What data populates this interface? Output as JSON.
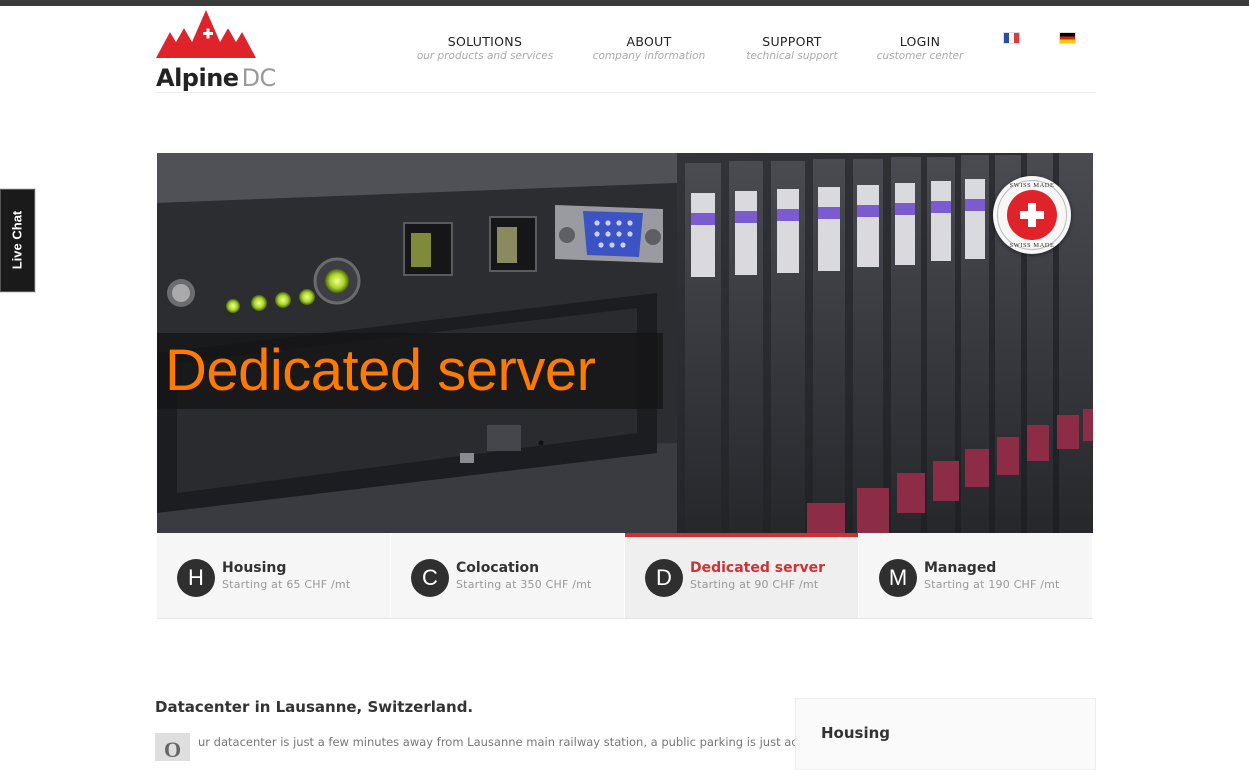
{
  "brand": {
    "name_bold": "Alpine",
    "name_light": "DC"
  },
  "nav": [
    {
      "title": "SOLUTIONS",
      "subtitle": "our products and services"
    },
    {
      "title": "ABOUT",
      "subtitle": "company information"
    },
    {
      "title": "SUPPORT",
      "subtitle": "technical support"
    },
    {
      "title": "LOGIN",
      "subtitle": "customer center"
    }
  ],
  "languages": [
    {
      "name": "French",
      "icon": "flag-fr"
    },
    {
      "name": "German",
      "icon": "flag-de"
    }
  ],
  "live_chat": "Live Chat",
  "hero": {
    "caption": "Dedicated server",
    "badge_top": "SWISS MADE",
    "badge_bottom": "SWISS MADE",
    "caption_color": "#ff7a00"
  },
  "tabs": [
    {
      "letter": "H",
      "title": "Housing",
      "subtitle": "Starting at 65 CHF /mt",
      "active": false
    },
    {
      "letter": "C",
      "title": "Colocation",
      "subtitle": "Starting at 350 CHF /mt",
      "active": false
    },
    {
      "letter": "D",
      "title": "Dedicated server",
      "subtitle": "Starting at 90 CHF /mt",
      "active": true
    },
    {
      "letter": "M",
      "title": "Managed",
      "subtitle": "Starting at 190 CHF /mt",
      "active": false
    }
  ],
  "content": {
    "heading": "Datacenter in Lausanne, Switzerland.",
    "dropcap": "O",
    "paragraph": "ur datacenter is just a few minutes away from Lausanne main railway station, a public parking is just across"
  },
  "sidebar": {
    "title": "Housing"
  },
  "colors": {
    "accent": "#d0302f",
    "topbar": "#3a3a3a"
  }
}
